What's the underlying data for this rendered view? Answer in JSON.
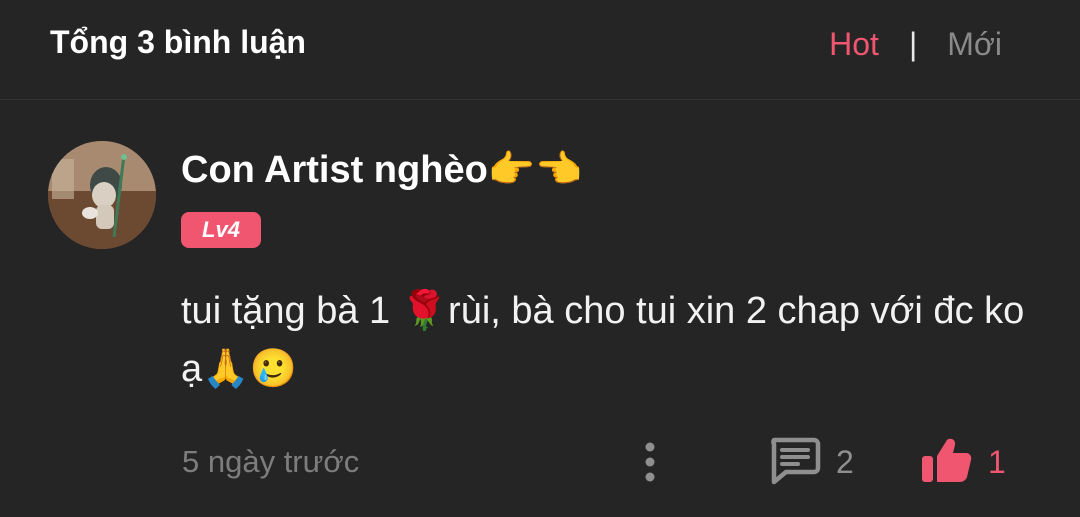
{
  "header": {
    "title": "Tổng 3 bình luận",
    "sort_hot": "Hot",
    "sort_separator": "|",
    "sort_new": "Mới"
  },
  "comment": {
    "username": "Con Artist nghèo👉👈",
    "level": "Lv4",
    "text": "tui tặng bà 1 🌹rùi, bà cho tui xin 2 chap với đc ko ạ🙏🥲",
    "time": "5 ngày trước",
    "reply_count": "2",
    "like_count": "1"
  },
  "colors": {
    "background": "#252526",
    "accent": "#f0566f",
    "muted": "#7d7d7d"
  },
  "icons": {
    "more": "more-vertical-icon",
    "reply": "comment-bubble-icon",
    "like": "thumbs-up-icon"
  }
}
